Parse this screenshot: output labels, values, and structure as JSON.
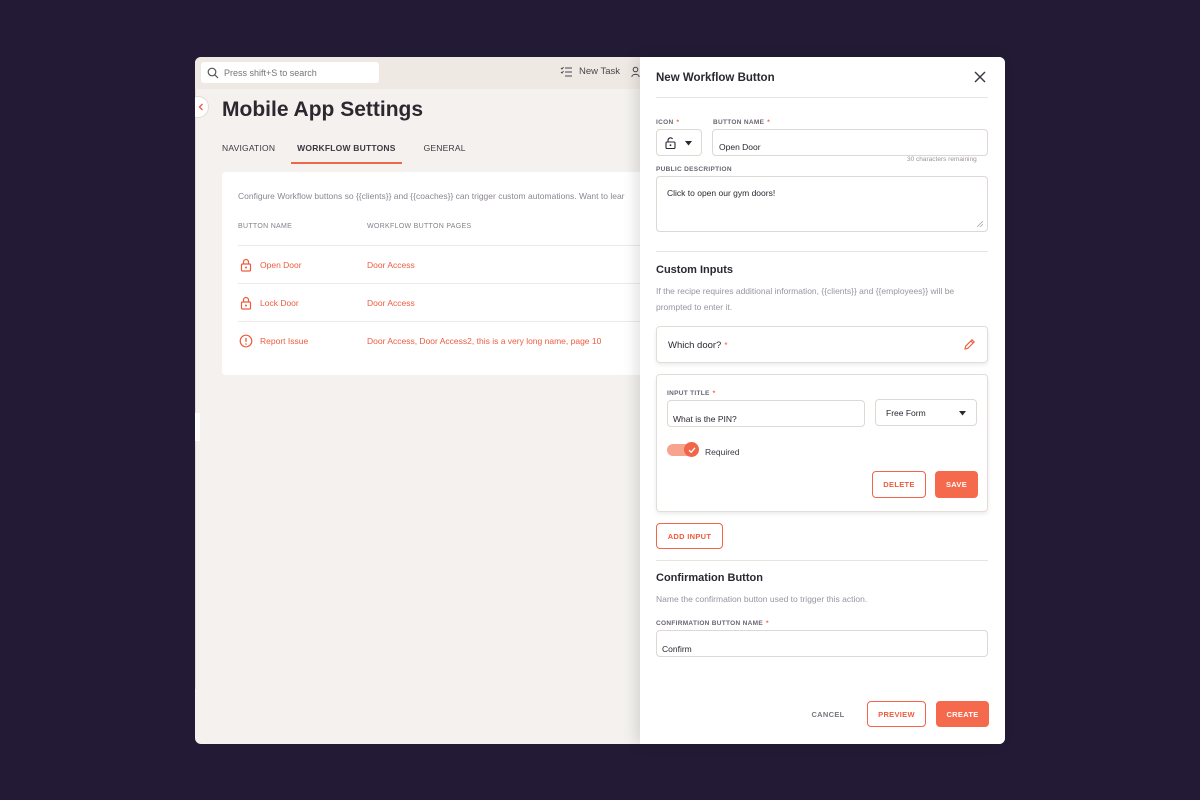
{
  "topbar": {
    "search_placeholder": "Press shift+S to search",
    "new_task": "New Task"
  },
  "page": {
    "title": "Mobile App Settings",
    "tabs": [
      {
        "label": "NAVIGATION",
        "active": false
      },
      {
        "label": "WORKFLOW BUTTONS",
        "active": true
      },
      {
        "label": "GENERAL",
        "active": false
      }
    ],
    "intro": "Configure Workflow buttons so {{clients}} and {{coaches}} can trigger custom automations. Want to lear",
    "columns": {
      "name": "BUTTON NAME",
      "pages": "WORKFLOW BUTTON PAGES"
    },
    "rows": [
      {
        "icon": "lock-icon",
        "name": "Open Door",
        "pages": "Door Access"
      },
      {
        "icon": "lock-icon",
        "name": "Lock Door",
        "pages": "Door Access"
      },
      {
        "icon": "alert-circle-icon",
        "name": "Report Issue",
        "pages": "Door Access, Door Access2, this is a very long name, page 10"
      }
    ]
  },
  "panel": {
    "title": "New Workflow Button",
    "icon_label": "ICON",
    "button_name_label": "BUTTON NAME",
    "button_name_value": "Open Door",
    "chars_remaining": "30 characters remaining",
    "public_desc_label": "PUBLIC DESCRIPTION",
    "public_desc_value": "Click to open our gym doors!",
    "custom_inputs": {
      "title": "Custom Inputs",
      "desc": "If the recipe requires additional information, {{clients}} and {{employees}} will be prompted to enter it.",
      "existing_input": "Which door?",
      "input_title_label": "INPUT TITLE",
      "input_title_value": "What is the PIN?",
      "type_value": "Free Form",
      "required_label": "Required",
      "delete_label": "DELETE",
      "save_label": "SAVE",
      "add_input_label": "ADD INPUT"
    },
    "confirmation": {
      "title": "Confirmation Button",
      "desc": "Name the confirmation button used to trigger this action.",
      "label": "CONFIRMATION BUTTON NAME",
      "value": "Confirm"
    },
    "footer": {
      "cancel": "CANCEL",
      "preview": "PREVIEW",
      "create": "CREATE"
    }
  },
  "colors": {
    "accent": "#f06648",
    "backdrop": "#231b35",
    "app_bg": "#f4f1ee"
  }
}
